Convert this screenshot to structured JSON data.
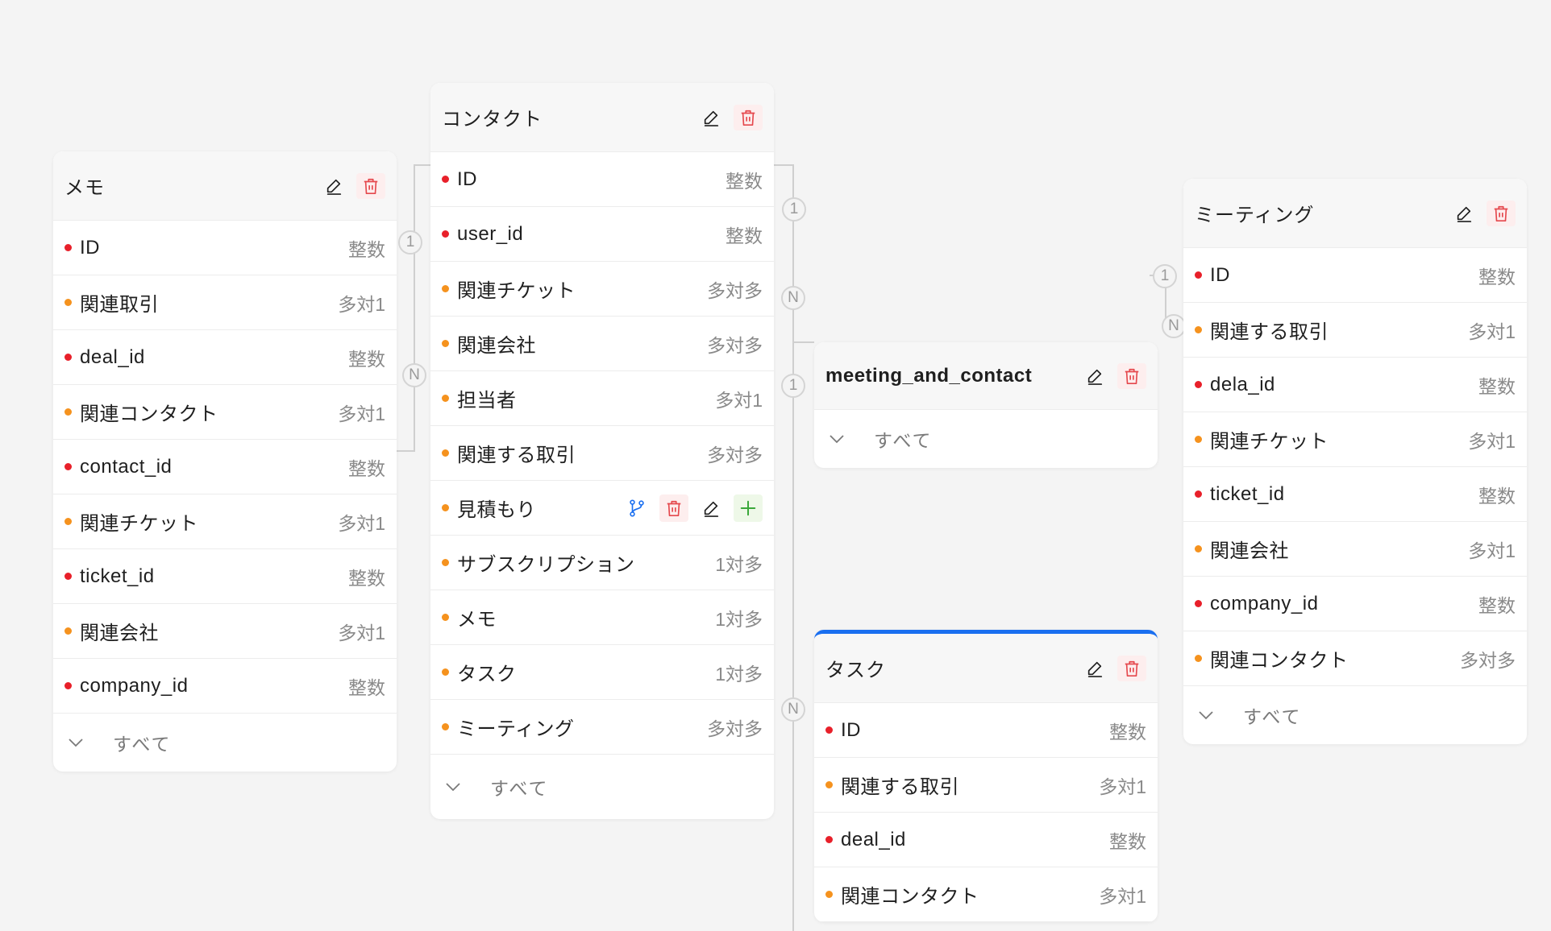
{
  "icons": {
    "edit": "pencil-icon",
    "delete": "trash-icon",
    "branch": "branch-icon",
    "add": "plus-icon",
    "expand": "chevron-down-icon"
  },
  "colors": {
    "key_dot": "#e8202a",
    "relation_dot": "#f5921e",
    "delete": "#e5484d",
    "branch": "#1a6ff0",
    "add": "#3aa83a",
    "active_border": "#1a6ff0"
  },
  "show_all_label": "すべて",
  "tables": {
    "memo": {
      "title": "メモ",
      "fields": [
        {
          "name": "ID",
          "type": "整数",
          "kind": "key"
        },
        {
          "name": "関連取引",
          "type": "多対1",
          "kind": "relation"
        },
        {
          "name": "deal_id",
          "type": "整数",
          "kind": "key"
        },
        {
          "name": "関連コンタクト",
          "type": "多対1",
          "kind": "relation"
        },
        {
          "name": "contact_id",
          "type": "整数",
          "kind": "key"
        },
        {
          "name": "関連チケット",
          "type": "多対1",
          "kind": "relation"
        },
        {
          "name": "ticket_id",
          "type": "整数",
          "kind": "key"
        },
        {
          "name": "関連会社",
          "type": "多対1",
          "kind": "relation"
        },
        {
          "name": "company_id",
          "type": "整数",
          "kind": "key"
        }
      ]
    },
    "contact": {
      "title": "コンタクト",
      "fields": [
        {
          "name": "ID",
          "type": "整数",
          "kind": "key"
        },
        {
          "name": "user_id",
          "type": "整数",
          "kind": "key"
        },
        {
          "name": "関連チケット",
          "type": "多対多",
          "kind": "relation"
        },
        {
          "name": "関連会社",
          "type": "多対多",
          "kind": "relation"
        },
        {
          "name": "担当者",
          "type": "多対1",
          "kind": "relation"
        },
        {
          "name": "関連する取引",
          "type": "多対多",
          "kind": "relation"
        },
        {
          "name": "見積もり",
          "type": "",
          "kind": "relation"
        },
        {
          "name": "サブスクリプション",
          "type": "1対多",
          "kind": "relation"
        },
        {
          "name": "メモ",
          "type": "1対多",
          "kind": "relation"
        },
        {
          "name": "タスク",
          "type": "1対多",
          "kind": "relation"
        },
        {
          "name": "ミーティング",
          "type": "多対多",
          "kind": "relation"
        }
      ]
    },
    "meeting_and_contact": {
      "title": "meeting_and_contact",
      "fields": []
    },
    "task": {
      "title": "タスク",
      "fields": [
        {
          "name": "ID",
          "type": "整数",
          "kind": "key"
        },
        {
          "name": "関連する取引",
          "type": "多対1",
          "kind": "relation"
        },
        {
          "name": "deal_id",
          "type": "整数",
          "kind": "key"
        },
        {
          "name": "関連コンタクト",
          "type": "多対1",
          "kind": "relation"
        }
      ]
    },
    "meeting": {
      "title": "ミーティング",
      "fields": [
        {
          "name": "ID",
          "type": "整数",
          "kind": "key"
        },
        {
          "name": "関連する取引",
          "type": "多対1",
          "kind": "relation"
        },
        {
          "name": "dela_id",
          "type": "整数",
          "kind": "key"
        },
        {
          "name": "関連チケット",
          "type": "多対1",
          "kind": "relation"
        },
        {
          "name": "ticket_id",
          "type": "整数",
          "kind": "key"
        },
        {
          "name": "関連会社",
          "type": "多対1",
          "kind": "relation"
        },
        {
          "name": "company_id",
          "type": "整数",
          "kind": "key"
        },
        {
          "name": "関連コンタクト",
          "type": "多対多",
          "kind": "relation"
        }
      ]
    }
  },
  "cardinality": {
    "memo_contact_one": "1",
    "memo_contact_many": "N",
    "contact_mc_one": "1",
    "contact_mc_many": "N",
    "mc_meeting_one": "1",
    "meeting_one": "1",
    "meeting_many": "N",
    "task_many": "N"
  }
}
